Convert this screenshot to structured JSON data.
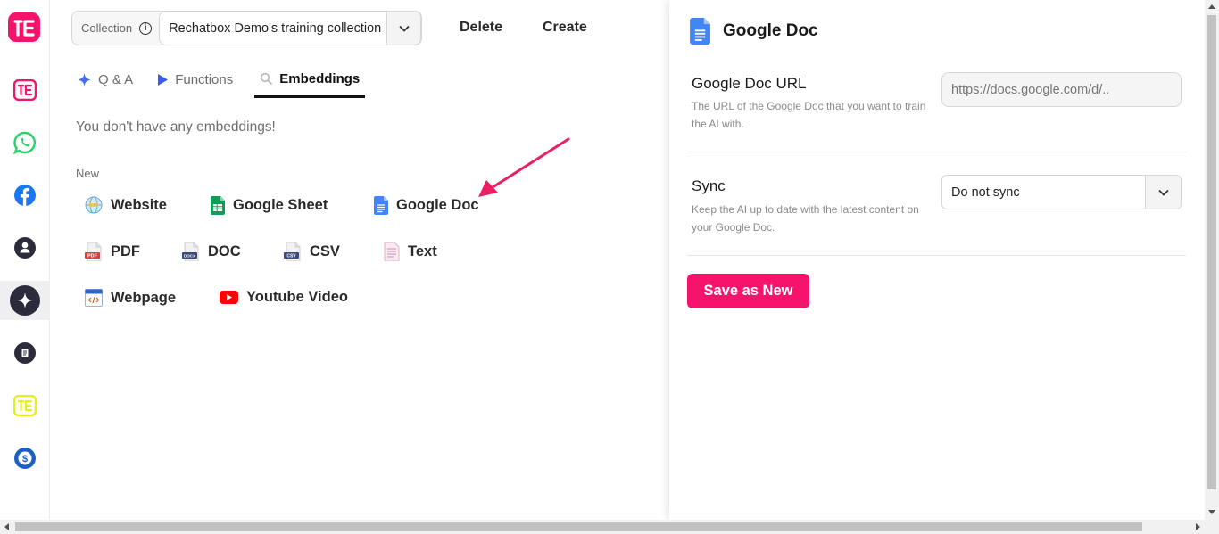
{
  "collection": {
    "label": "Collection",
    "selected": "Rechatbox Demo's training collection"
  },
  "toolbar": {
    "delete_label": "Delete",
    "create_label": "Create"
  },
  "tabs": [
    {
      "label": "Q & A",
      "icon": "sparkle-icon",
      "active": false
    },
    {
      "label": "Functions",
      "icon": "play-icon",
      "active": false
    },
    {
      "label": "Embeddings",
      "icon": "search-icon",
      "active": true
    }
  ],
  "embeddings": {
    "empty_message": "You don't have any embeddings!",
    "new_label": "New",
    "sources": [
      {
        "label": "Website",
        "icon": "website-icon"
      },
      {
        "label": "Google Sheet",
        "icon": "google-sheet-icon"
      },
      {
        "label": "Google Doc",
        "icon": "google-doc-icon"
      },
      {
        "label": "PDF",
        "icon": "pdf-icon"
      },
      {
        "label": "DOC",
        "icon": "doc-icon"
      },
      {
        "label": "CSV",
        "icon": "csv-icon"
      },
      {
        "label": "Text",
        "icon": "text-file-icon"
      },
      {
        "label": "Webpage",
        "icon": "webpage-icon"
      },
      {
        "label": "Youtube Video",
        "icon": "youtube-icon"
      }
    ],
    "icon_text": {
      "pdf": "PDF",
      "doc": "DOCX",
      "csv": "CSV"
    }
  },
  "rail": {
    "items": [
      {
        "name": "rechatbox-logo",
        "icon": "rechatbox-logo-icon",
        "color": "#f5136b"
      },
      {
        "name": "rechatbox",
        "icon": "rechatbox-icon",
        "color": "#f5136b"
      },
      {
        "name": "whatsapp",
        "icon": "whatsapp-icon",
        "color": "#25d366"
      },
      {
        "name": "facebook",
        "icon": "facebook-icon",
        "color": "#1877f2"
      },
      {
        "name": "contacts",
        "icon": "user-icon",
        "color": "#2b2b3c"
      },
      {
        "name": "ai-training",
        "icon": "sparkle-icon",
        "color": "#2b2b3c",
        "active": true
      },
      {
        "name": "documents",
        "icon": "document-icon",
        "color": "#2b2b3c"
      },
      {
        "name": "rechatbox-alt",
        "icon": "rechatbox-icon",
        "color": "#e4f01a"
      },
      {
        "name": "billing",
        "icon": "dollar-icon",
        "color": "#1d5fc4"
      }
    ]
  },
  "panel": {
    "title": "Google Doc",
    "url_field": {
      "title": "Google Doc URL",
      "description": "The URL of the Google Doc that you want to train the AI with.",
      "placeholder": "https://docs.google.com/d/..",
      "value": ""
    },
    "sync_field": {
      "title": "Sync",
      "description": "Keep the AI up to date with the latest content on your Google Doc.",
      "selected": "Do not sync"
    },
    "save_label": "Save as New"
  },
  "colors": {
    "brand": "#f5136b",
    "rail_dark": "#2b2b3c",
    "google_doc_blue": "#4285f4",
    "google_sheet_green": "#0f9d58",
    "youtube_red": "#ff0000"
  }
}
